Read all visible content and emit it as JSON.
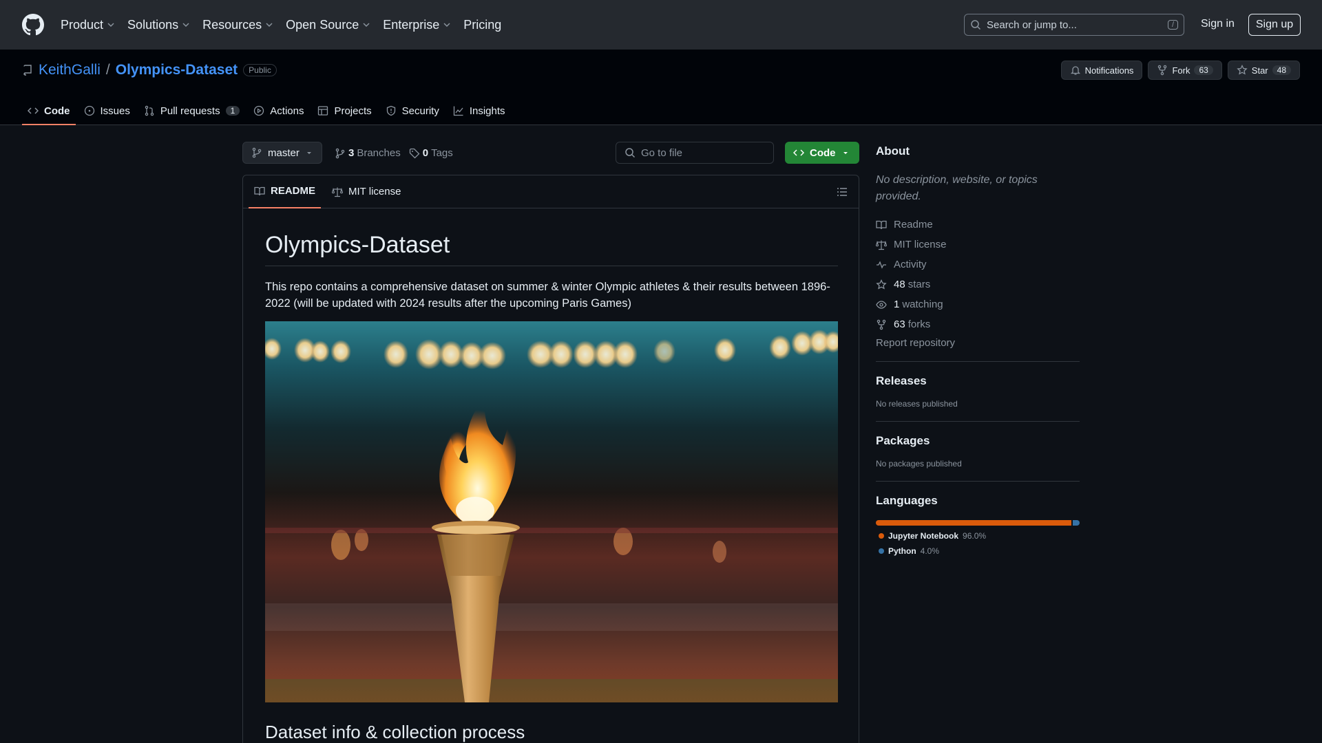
{
  "topnav": {
    "items": [
      "Product",
      "Solutions",
      "Resources",
      "Open Source",
      "Enterprise",
      "Pricing"
    ],
    "search_placeholder": "Search or jump to...",
    "search_shortcut": "/",
    "signin": "Sign in",
    "signup": "Sign up"
  },
  "repo": {
    "owner": "KeithGalli",
    "separator": "/",
    "name": "Olympics-Dataset",
    "visibility": "Public",
    "notifications": "Notifications",
    "fork_label": "Fork",
    "fork_count": "63",
    "star_label": "Star",
    "star_count": "48"
  },
  "tabs": {
    "code": "Code",
    "issues": "Issues",
    "pulls": "Pull requests",
    "pulls_count": "1",
    "actions": "Actions",
    "projects": "Projects",
    "security": "Security",
    "insights": "Insights"
  },
  "filebar": {
    "branch": "master",
    "branches_count": "3",
    "branches_label": "Branches",
    "tags_count": "0",
    "tags_label": "Tags",
    "goto_placeholder": "Go to file",
    "code_button": "Code"
  },
  "readme": {
    "tab_readme": "README",
    "tab_license": "MIT license",
    "title": "Olympics-Dataset",
    "body": "This repo contains a comprehensive dataset on summer & winter Olympic athletes & their results between 1896-2022 (will be updated with 2024 results after the upcoming Paris Games)",
    "section2": "Dataset info & collection process"
  },
  "about": {
    "heading": "About",
    "description": "No description, website, or topics provided.",
    "readme": "Readme",
    "license": "MIT license",
    "activity": "Activity",
    "stars_count": "48",
    "stars_label": "stars",
    "watching_count": "1",
    "watching_label": "watching",
    "forks_count": "63",
    "forks_label": "forks",
    "report": "Report repository"
  },
  "releases": {
    "heading": "Releases",
    "note": "No releases published"
  },
  "packages": {
    "heading": "Packages",
    "note": "No packages published"
  },
  "languages": {
    "heading": "Languages",
    "items": [
      {
        "name": "Jupyter Notebook",
        "percent": "96.0%",
        "color": "#DA5B0B"
      },
      {
        "name": "Python",
        "percent": "4.0%",
        "color": "#3572A5"
      }
    ]
  }
}
